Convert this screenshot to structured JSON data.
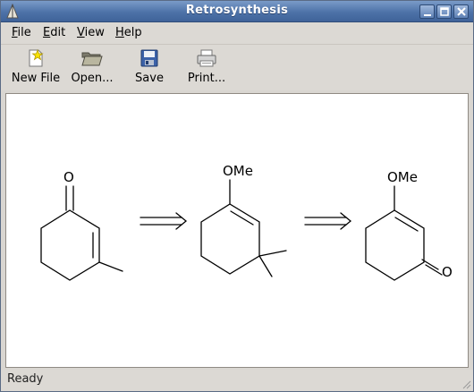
{
  "window": {
    "title": "Retrosynthesis"
  },
  "menu": {
    "items": [
      {
        "mnemonic": "F",
        "rest": "ile"
      },
      {
        "mnemonic": "E",
        "rest": "dit"
      },
      {
        "mnemonic": "V",
        "rest": "iew"
      },
      {
        "mnemonic": "H",
        "rest": "elp"
      }
    ]
  },
  "toolbar": {
    "new_label": "New File",
    "open_label": "Open...",
    "save_label": "Save",
    "print_label": "Print..."
  },
  "canvas": {
    "molecules": [
      {
        "atom_label": "O"
      },
      {
        "atom_label": "OMe"
      },
      {
        "atom_label": "OMe",
        "atom_label_2": "O"
      }
    ]
  },
  "status": {
    "text": "Ready"
  }
}
